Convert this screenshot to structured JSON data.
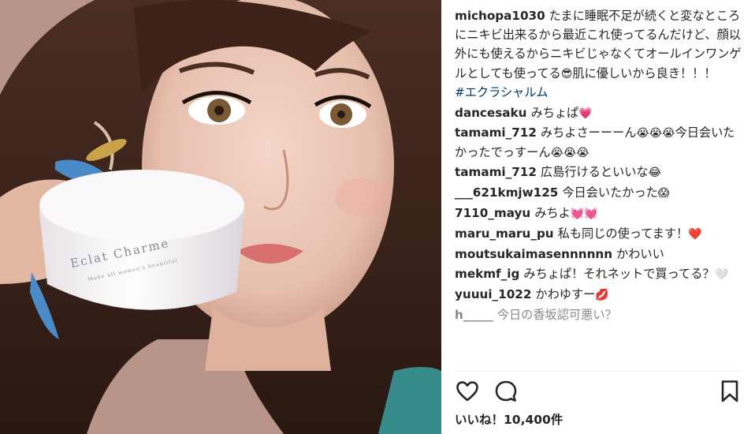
{
  "photo": {
    "product_brand": "Eclat Charme",
    "product_tagline": "Make all women's beautiful",
    "colors": {
      "jar": "#f6f3f5",
      "hair": "#3a241d",
      "skin": "#e9c4b3"
    }
  },
  "caption": {
    "username": "michopa1030",
    "text": "たまに睡眠不足が続くと変なところにニキビ出来るから最近これ使ってるんだけど、顔以外にも使えるからニキビじゃなくてオールインワンゲルとしても使ってる",
    "emoji": "😎",
    "text2": "肌に優しいから良き！！！",
    "hashtag": "#エクラシャルム"
  },
  "comments": [
    {
      "username": "dancesaku",
      "text": "みちょぱ",
      "emoji": "💗"
    },
    {
      "username": "tamami_712",
      "text": "みちよさーーーん",
      "emoji": "😭😭😭",
      "text2": "今日会いたかったでっすーん",
      "emoji2": "😭😭😭"
    },
    {
      "username": "tamami_712",
      "text": "広島行けるといいな",
      "emoji": "😂"
    },
    {
      "username": "___621kmjw125",
      "text": "今日会いたかった",
      "emoji": "😱"
    },
    {
      "username": "7110_mayu",
      "text": "みちよ",
      "emoji": "💓💓"
    },
    {
      "username": "maru_maru_pu",
      "text": "私も同じの使ってます！",
      "emoji": "❤️"
    },
    {
      "username": "moutsukaimasennnnnn",
      "text": "かわいい"
    },
    {
      "username": "mekmf_ig",
      "text": "みちょぱ！それネットで買ってる？",
      "emoji": "🤍"
    },
    {
      "username": "yuuui_1022",
      "text": "かわゆすー",
      "emoji": "💋"
    },
    {
      "username": "h_____",
      "text": "今日の香坂認可悪い？"
    }
  ],
  "actions": {
    "like_icon": "heart-outline-icon",
    "comment_icon": "speech-bubble-icon",
    "save_icon": "bookmark-icon"
  },
  "likes": {
    "text": "いいね！10,400件"
  },
  "colors": {
    "text": "#262626",
    "hashtag": "#003569",
    "divider": "#efefef"
  }
}
